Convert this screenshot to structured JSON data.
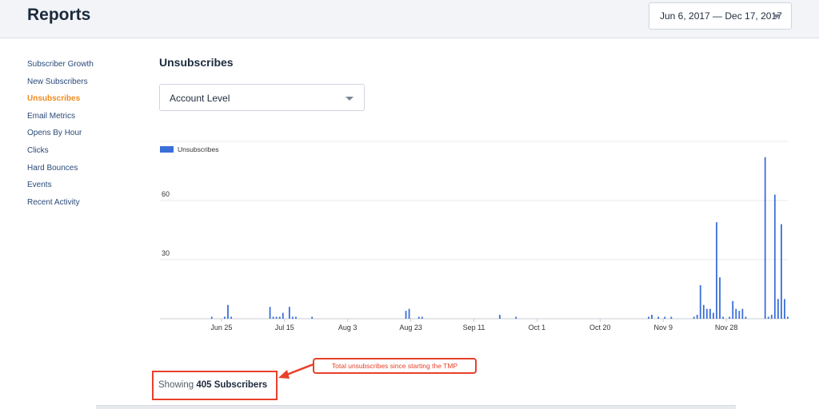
{
  "header": {
    "title": "Reports",
    "date_range": "Jun 6, 2017 — Dec 17, 2017"
  },
  "sidebar": {
    "items": [
      {
        "label": "Subscriber Growth",
        "active": false
      },
      {
        "label": "New Subscribers",
        "active": false
      },
      {
        "label": "Unsubscribes",
        "active": true
      },
      {
        "label": "Email Metrics",
        "active": false
      },
      {
        "label": "Opens By Hour",
        "active": false
      },
      {
        "label": "Clicks",
        "active": false
      },
      {
        "label": "Hard Bounces",
        "active": false
      },
      {
        "label": "Events",
        "active": false
      },
      {
        "label": "Recent Activity",
        "active": false
      }
    ]
  },
  "main": {
    "title": "Unsubscribes",
    "level_select": "Account Level",
    "showing_prefix": "Showing",
    "showing_count": "405 Subscribers"
  },
  "annotation": {
    "callout_text": "Total unsubscribes since starting the TMP",
    "color": "#e8402a"
  },
  "colors": {
    "accent": "#ef8b1f",
    "series": "#3a6fd8"
  },
  "chart_data": {
    "type": "bar",
    "legend": "Unsubscribes",
    "start_date": "2017-06-06",
    "end_date": "2017-12-17",
    "ylim": [
      0,
      90
    ],
    "yticks": [
      30,
      60
    ],
    "xticks": [
      "Jun 25",
      "Jul 15",
      "Aug 3",
      "Aug 23",
      "Sep 11",
      "Oct 1",
      "Oct 20",
      "Nov 9",
      "Nov 28"
    ],
    "points": [
      {
        "x": "2017-06-22",
        "y": 1
      },
      {
        "x": "2017-06-26",
        "y": 1
      },
      {
        "x": "2017-06-27",
        "y": 7
      },
      {
        "x": "2017-06-28",
        "y": 1
      },
      {
        "x": "2017-07-10",
        "y": 6
      },
      {
        "x": "2017-07-11",
        "y": 1
      },
      {
        "x": "2017-07-12",
        "y": 1
      },
      {
        "x": "2017-07-13",
        "y": 1
      },
      {
        "x": "2017-07-14",
        "y": 3
      },
      {
        "x": "2017-07-16",
        "y": 6
      },
      {
        "x": "2017-07-17",
        "y": 1
      },
      {
        "x": "2017-07-18",
        "y": 1
      },
      {
        "x": "2017-07-23",
        "y": 1
      },
      {
        "x": "2017-08-21",
        "y": 4
      },
      {
        "x": "2017-08-22",
        "y": 5
      },
      {
        "x": "2017-08-25",
        "y": 1
      },
      {
        "x": "2017-08-26",
        "y": 1
      },
      {
        "x": "2017-09-19",
        "y": 2
      },
      {
        "x": "2017-09-24",
        "y": 1
      },
      {
        "x": "2017-11-04",
        "y": 1
      },
      {
        "x": "2017-11-05",
        "y": 2
      },
      {
        "x": "2017-11-07",
        "y": 1
      },
      {
        "x": "2017-11-09",
        "y": 1
      },
      {
        "x": "2017-11-11",
        "y": 1
      },
      {
        "x": "2017-11-18",
        "y": 1
      },
      {
        "x": "2017-11-19",
        "y": 2
      },
      {
        "x": "2017-11-20",
        "y": 17
      },
      {
        "x": "2017-11-21",
        "y": 7
      },
      {
        "x": "2017-11-22",
        "y": 5
      },
      {
        "x": "2017-11-23",
        "y": 5
      },
      {
        "x": "2017-11-24",
        "y": 3
      },
      {
        "x": "2017-11-25",
        "y": 49
      },
      {
        "x": "2017-11-26",
        "y": 21
      },
      {
        "x": "2017-11-27",
        "y": 1
      },
      {
        "x": "2017-11-29",
        "y": 1
      },
      {
        "x": "2017-11-30",
        "y": 9
      },
      {
        "x": "2017-12-01",
        "y": 5
      },
      {
        "x": "2017-12-02",
        "y": 4
      },
      {
        "x": "2017-12-03",
        "y": 5
      },
      {
        "x": "2017-12-04",
        "y": 1
      },
      {
        "x": "2017-12-10",
        "y": 82
      },
      {
        "x": "2017-12-11",
        "y": 1
      },
      {
        "x": "2017-12-12",
        "y": 2
      },
      {
        "x": "2017-12-13",
        "y": 63
      },
      {
        "x": "2017-12-14",
        "y": 10
      },
      {
        "x": "2017-12-15",
        "y": 48
      },
      {
        "x": "2017-12-16",
        "y": 10
      },
      {
        "x": "2017-12-17",
        "y": 1
      }
    ]
  }
}
